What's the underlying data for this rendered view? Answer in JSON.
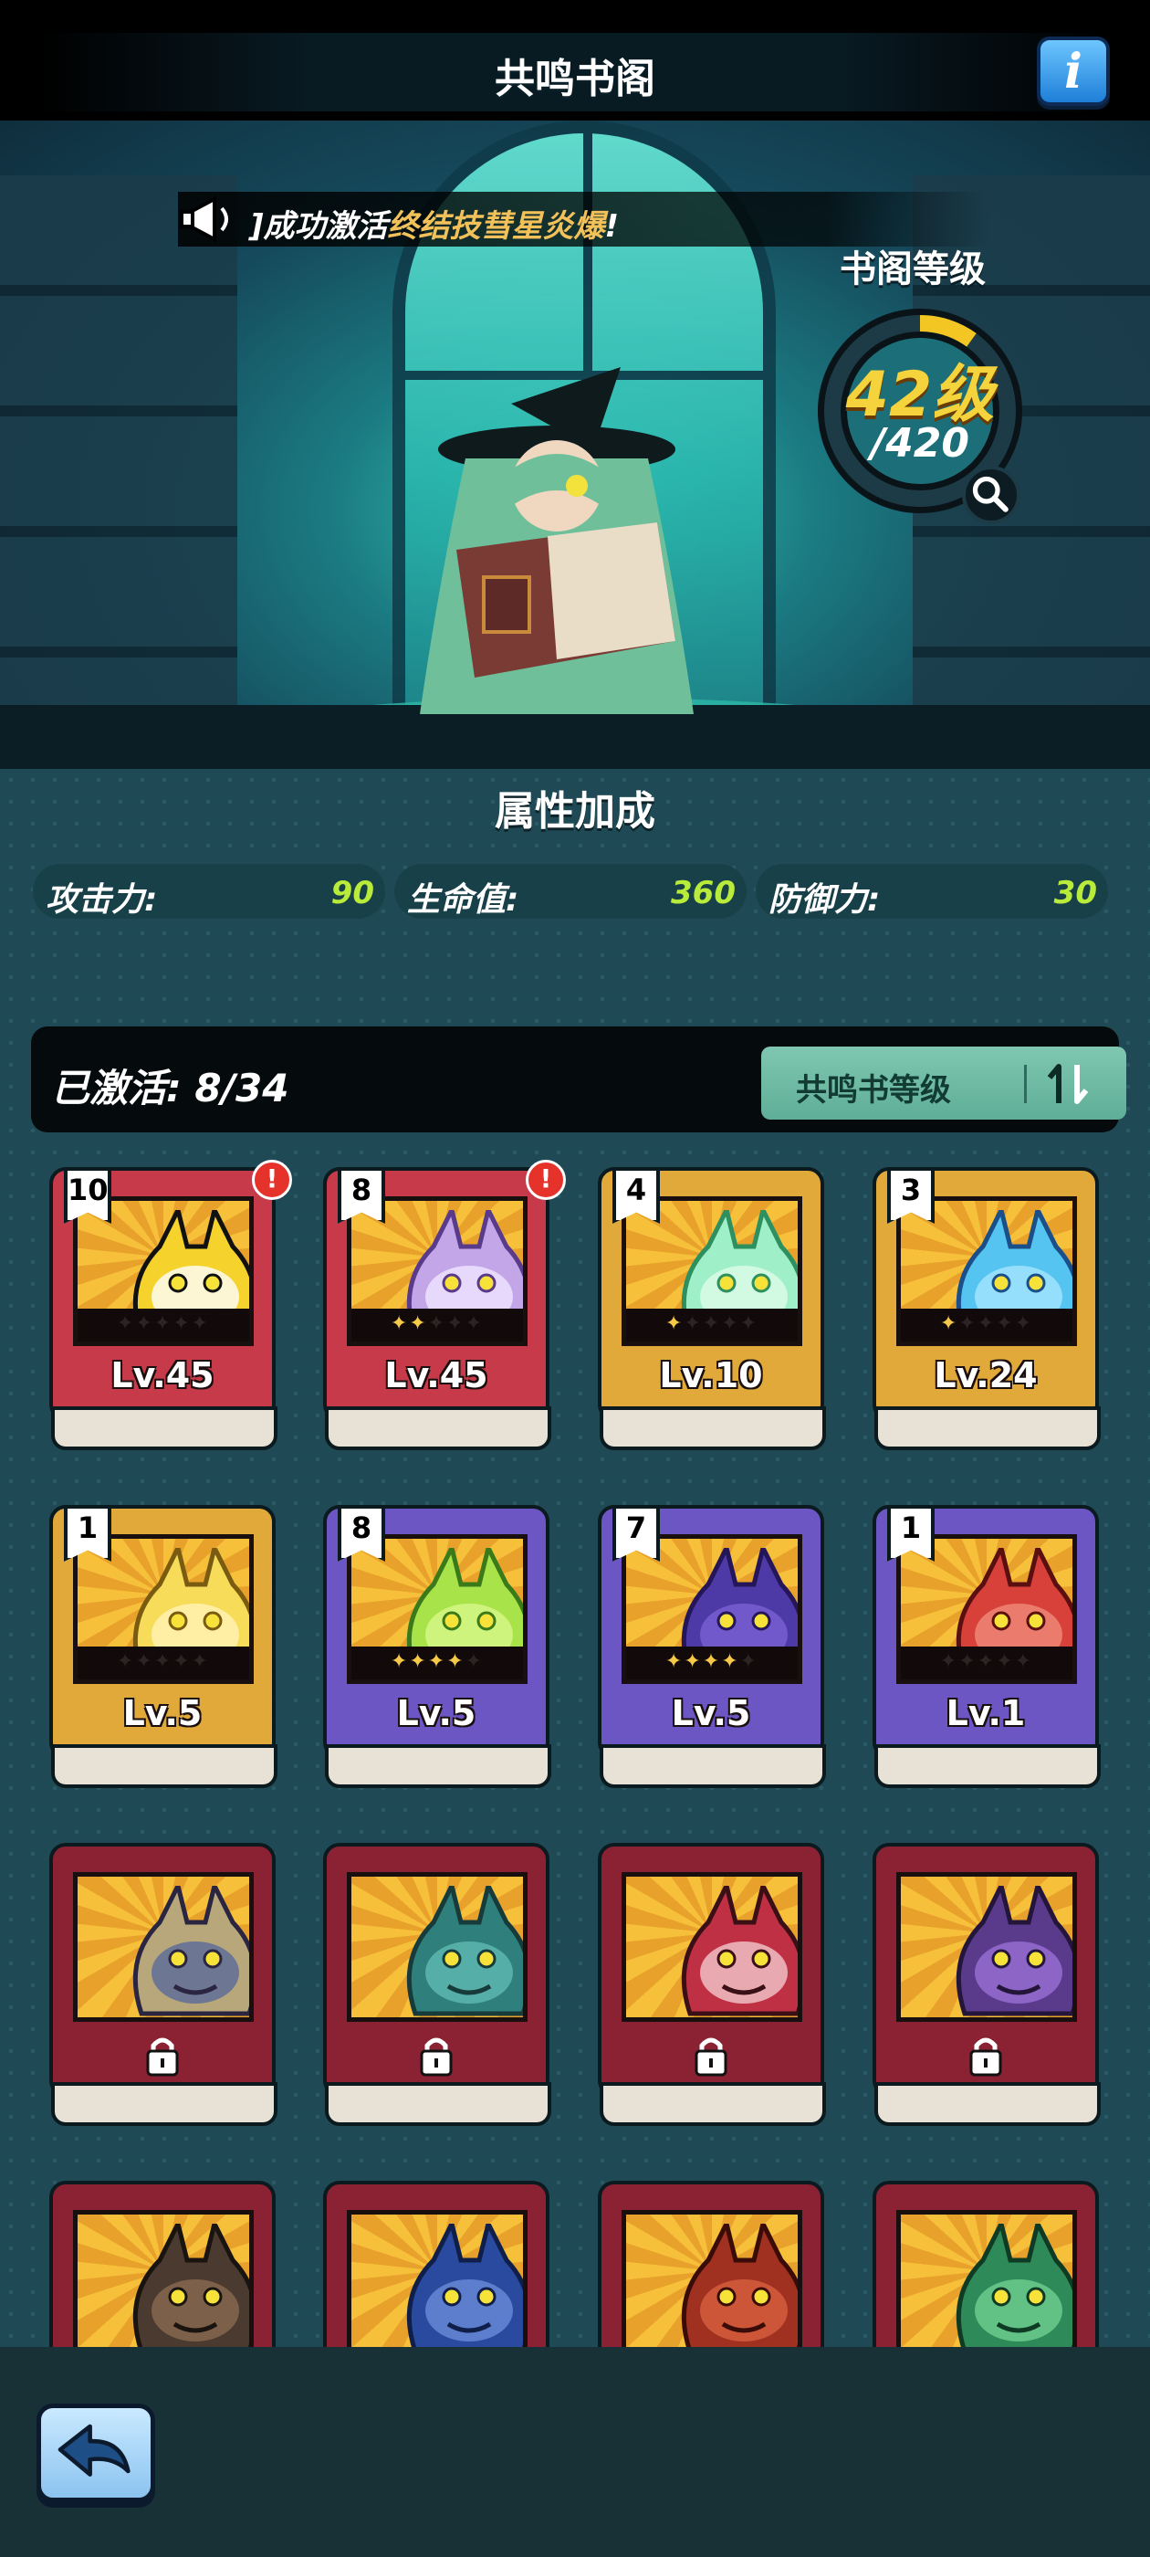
{
  "header": {
    "title": "共鸣书阁",
    "info_button_label": "i"
  },
  "announcement": {
    "prefix": "]成功激活",
    "highlight": "终结技彗星炎爆",
    "suffix": "!"
  },
  "library_level": {
    "label": "书阁等级",
    "level": "42级",
    "max": "/420",
    "progress": 0.1
  },
  "attributes": {
    "title": "属性加成",
    "items": [
      {
        "name": "攻击力:",
        "value": "90"
      },
      {
        "name": "生命值:",
        "value": "360"
      },
      {
        "name": "防御力:",
        "value": "30"
      }
    ]
  },
  "activated": {
    "label": "已激活: 8/34",
    "sort_label": "共鸣书等级"
  },
  "cards": [
    {
      "badge": "10",
      "level": "Lv.45",
      "stars": 0,
      "color": "red",
      "alert": true,
      "monster": "antlered-spirit"
    },
    {
      "badge": "8",
      "level": "Lv.45",
      "stars": 2,
      "color": "red",
      "alert": true,
      "monster": "purple-ghost"
    },
    {
      "badge": "4",
      "level": "Lv.10",
      "stars": 1,
      "color": "gold",
      "alert": false,
      "monster": "green-owl"
    },
    {
      "badge": "3",
      "level": "Lv.24",
      "stars": 1,
      "color": "gold",
      "alert": false,
      "monster": "ice-crystal"
    },
    {
      "badge": "1",
      "level": "Lv.5",
      "stars": 0,
      "color": "gold",
      "alert": false,
      "monster": "golden-knight"
    },
    {
      "badge": "8",
      "level": "Lv.5",
      "stars": 4,
      "color": "purple",
      "alert": false,
      "monster": "green-sprout"
    },
    {
      "badge": "7",
      "level": "Lv.5",
      "stars": 4,
      "color": "purple",
      "alert": false,
      "monster": "purple-beast"
    },
    {
      "badge": "1",
      "level": "Lv.1",
      "stars": 0,
      "color": "purple",
      "alert": false,
      "monster": "red-horned-monster"
    },
    {
      "locked": true,
      "monster": "golden-dragon"
    },
    {
      "locked": true,
      "monster": "teal-dragon"
    },
    {
      "locked": true,
      "monster": "red-skull-beast"
    },
    {
      "locked": true,
      "monster": "shadow-dragon"
    },
    {
      "locked": true,
      "monster": "dark-serpent"
    },
    {
      "locked": true,
      "monster": "blue-shark"
    },
    {
      "locked": true,
      "monster": "red-dragon"
    },
    {
      "locked": true,
      "monster": "green-wyrm"
    }
  ],
  "icons": {
    "info": "info-icon",
    "announce": "megaphone-icon",
    "search": "magnifier-icon",
    "sort": "sort-arrows-icon",
    "back": "back-arrow-icon",
    "lock": "lock-icon",
    "alert": "exclamation-icon"
  },
  "colors": {
    "red": "#c73a4a",
    "gold": "#e0a93a",
    "purple": "#6b56c4",
    "locked": "#8a2233",
    "value_green": "#b9ec3a",
    "level_yellow": "#f5d33c"
  }
}
